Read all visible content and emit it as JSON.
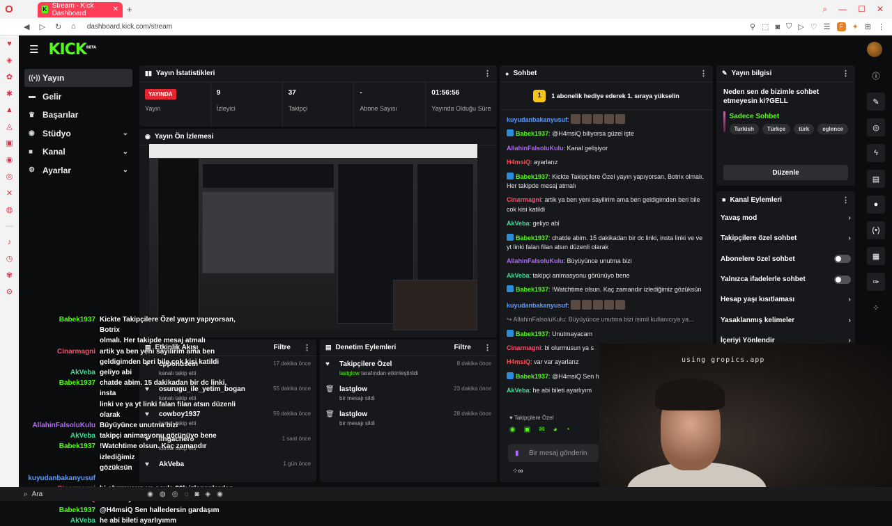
{
  "browser": {
    "tab_title": "Stream - Kick Dashboard",
    "url": "dashboard.kick.com/stream",
    "opera_sidebar_icons": [
      "heart-icon",
      "gift-icon",
      "bug-icon",
      "star-icon",
      "cube-icon",
      "warning-icon",
      "twitch-icon",
      "whatsapp-icon",
      "instagram-icon",
      "x-icon",
      "discord-icon",
      "music-icon",
      "clock-icon",
      "gift-icon",
      "gear-icon"
    ],
    "taskbar_search": "Ara"
  },
  "brand": {
    "logo": "KICK",
    "logo_sup": "BETA",
    "accent": "#53fc18",
    "live_red": "#e5252f"
  },
  "nav": {
    "items": [
      {
        "label": "Yayın",
        "icon": "broadcast-icon",
        "active": true,
        "chevron": false
      },
      {
        "label": "Gelir",
        "icon": "wallet-icon",
        "active": false,
        "chevron": false
      },
      {
        "label": "Başarılar",
        "icon": "trophy-icon",
        "active": false,
        "chevron": false
      },
      {
        "label": "Stüdyo",
        "icon": "studio-icon",
        "active": false,
        "chevron": true
      },
      {
        "label": "Kanal",
        "icon": "channel-icon",
        "active": false,
        "chevron": true
      },
      {
        "label": "Ayarlar",
        "icon": "gear-icon",
        "active": false,
        "chevron": true
      }
    ]
  },
  "stats": {
    "title": "Yayın İstatistikleri",
    "live_badge": "YAYINDA",
    "items": [
      {
        "value": "",
        "label": "Yayın"
      },
      {
        "value": "9",
        "label": "İzleyici"
      },
      {
        "value": "37",
        "label": "Takipçi"
      },
      {
        "value": "-",
        "label": "Abone Sayısı"
      },
      {
        "value": "01:56:56",
        "label": "Yayında Olduğu Süre"
      }
    ]
  },
  "preview": {
    "title": "Yayın Ön İzlemesi"
  },
  "activity": {
    "title": "Etkinlik Akışı",
    "filter": "Filtre",
    "items": [
      {
        "name": "cppohusein",
        "sub": "kanalı takip etti",
        "time": "17 dakika önce"
      },
      {
        "name": "osurugu_ile_yetim_bogan",
        "sub": "kanalı takip etti",
        "time": "55 dakika önce"
      },
      {
        "name": "cowboy1937",
        "sub": "kanalı takip etti",
        "time": "59 dakika önce"
      },
      {
        "name": "lingachero",
        "sub": "kanalı takip etti",
        "time": "1 saat önce"
      },
      {
        "name": "AkVeba",
        "sub": "",
        "time": "1 gün önce"
      }
    ]
  },
  "moderation": {
    "title": "Denetim Eylemleri",
    "filter": "Filtre",
    "items": [
      {
        "icon": "heart-icon",
        "name": "Takipçilere Özel",
        "actor": "lastglow",
        "sub": "tarafından etkinleştirildi",
        "time": "8 dakika önce"
      },
      {
        "icon": "trash-icon",
        "name": "lastglow",
        "actor": "",
        "sub": "bir mesajı sildi",
        "time": "23 dakika önce"
      },
      {
        "icon": "trash-icon",
        "name": "lastglow",
        "actor": "",
        "sub": "bir mesajı sildi",
        "time": "28 dakika önce"
      }
    ]
  },
  "chat": {
    "title": "Sohbet",
    "banner_rank": "1",
    "banner": "1 abonelik hediye ederek 1. sıraya yükselin",
    "messages": [
      {
        "user": "kuyudanbakanyusuf",
        "color": "#5b9bff",
        "badge": false,
        "text": ""
      },
      {
        "user": "Babek1937",
        "color": "#53fc18",
        "badge": true,
        "text": "@H4msiQ biliyorsa güzel işte"
      },
      {
        "user": "AllahinFalsoluKulu",
        "color": "#b266ff",
        "badge": false,
        "text": "Kanal gelişiyor"
      },
      {
        "user": "H4msiQ",
        "color": "#ff4d4d",
        "badge": false,
        "text": "ayarlarız"
      },
      {
        "user": "Babek1937",
        "color": "#53fc18",
        "badge": true,
        "text": "Kickte Takipçilere Özel yayın yapıyorsan, Botrix olmalı. Her takipde mesaj atmalı"
      },
      {
        "user": "Cinarmagni",
        "color": "#ff4d6d",
        "badge": false,
        "text": "artik ya ben yeni sayilirim ama ben geldigimden beri bile cok kisi katildi"
      },
      {
        "user": "AkVeba",
        "color": "#3ddc97",
        "badge": false,
        "text": "geliyo abi"
      },
      {
        "user": "Babek1937",
        "color": "#53fc18",
        "badge": true,
        "text": "chatde abim. 15 dakikadan bir dc linki, insta linki ve ve yt linki falan filan atsın düzenli olarak"
      },
      {
        "user": "AllahinFalsoluKulu",
        "color": "#b266ff",
        "badge": false,
        "text": "Büyüyünce unutma bizi"
      },
      {
        "user": "AkVeba",
        "color": "#3ddc97",
        "badge": false,
        "text": "takipçi animasyonu görünüyo bene"
      },
      {
        "user": "Babek1937",
        "color": "#53fc18",
        "badge": true,
        "text": "!Watchtime olsun. Kaç zamandır izlediğimiz gözüksün"
      },
      {
        "user": "kuyudanbakanyusuf",
        "color": "#5b9bff",
        "badge": false,
        "text": ""
      },
      {
        "user": "",
        "color": "#999",
        "badge": false,
        "text": "↪ AllahinFalsoluKulu: Büyüyünce unutma bizi isimli kullanıcıya ya..."
      },
      {
        "user": "Babek1937",
        "color": "#53fc18",
        "badge": true,
        "text": "Unutmayacam"
      },
      {
        "user": "Cinarmagni",
        "color": "#ff4d6d",
        "badge": false,
        "text": "bi olurmusun ya s"
      },
      {
        "user": "H4msiQ",
        "color": "#ff4d4d",
        "badge": false,
        "text": "var var ayarlarız"
      },
      {
        "user": "Babek1937",
        "color": "#53fc18",
        "badge": true,
        "text": "@H4msiQ Sen h"
      },
      {
        "user": "AkVeba",
        "color": "#3ddc97",
        "badge": false,
        "text": "he abi bileti ayarlıyım"
      }
    ],
    "mode_label": "Takipçilere Özel",
    "input_placeholder": "Bir mesaj gönderin"
  },
  "info": {
    "title": "Yayın bilgisi",
    "stream_title": "Neden sen de bizimle sohbet etmeyesin ki?GELL",
    "category": "Sadece Sohbet",
    "tags": [
      "Turkish",
      "Türkçe",
      "türk",
      "eglence"
    ],
    "edit_label": "Düzenle"
  },
  "channel_actions": {
    "title": "Kanal Eylemleri",
    "items": [
      {
        "label": "Yavaş mod",
        "type": "arrow"
      },
      {
        "label": "Takipçilere özel sohbet",
        "type": "arrow"
      },
      {
        "label": "Abonelere özel sohbet",
        "type": "toggle"
      },
      {
        "label": "Yalnızca ifadelerle sohbet",
        "type": "toggle"
      },
      {
        "label": "Hesap yaşı kısıtlaması",
        "type": "arrow"
      },
      {
        "label": "Yasaklanmış kelimeler",
        "type": "arrow"
      },
      {
        "label": "İçeriyi Yönlendir",
        "type": "arrow"
      }
    ]
  },
  "rail": {
    "icons": [
      "info-icon",
      "pencil-icon",
      "target-icon",
      "bolt-icon",
      "document-icon",
      "chat-bubble-icon",
      "broadcast-icon",
      "save-icon",
      "wrench-icon",
      "dots-icon"
    ]
  },
  "overlay_chat": {
    "lines": [
      {
        "user": "Babek1937",
        "color": "#53fc18",
        "text": "Kickte Takipçilere Özel yayın yapıyorsan, Botrix"
      },
      {
        "user": "",
        "color": "#53fc18",
        "text": "olmalı. Her takipde mesaj atmalı"
      },
      {
        "user": "Cinarmagni",
        "color": "#ff4d6d",
        "text": "artik ya ben yeni sayilirim ama ben"
      },
      {
        "user": "",
        "color": "#ff4d6d",
        "text": "geldigimden beri bile cok kisi katildi"
      },
      {
        "user": "AkVeba",
        "color": "#3ddc97",
        "text": "geliyo abi"
      },
      {
        "user": "Babek1937",
        "color": "#53fc18",
        "text": "chatde abim. 15 dakikadan bir dc linki, insta"
      },
      {
        "user": "",
        "color": "#53fc18",
        "text": "linki ve ya yt linki falan filan atsın düzenli"
      },
      {
        "user": "",
        "color": "#53fc18",
        "text": "olarak"
      },
      {
        "user": "AllahinFalsoluKulu",
        "color": "#b266ff",
        "text": "Büyüyünce unutma bizi"
      },
      {
        "user": "AkVeba",
        "color": "#3ddc97",
        "text": "takipçi animasyonu görünüyo bene"
      },
      {
        "user": "Babek1937",
        "color": "#53fc18",
        "text": "!Watchtime olsun. Kaç zamandır izlediğimiz"
      },
      {
        "user": "",
        "color": "#53fc18",
        "text": "gözüksün"
      },
      {
        "user": "kuyudanbakanyusuf",
        "color": "#5b9bff",
        "text": ""
      },
      {
        "user": "Cinarmagni",
        "color": "#ff4d6d",
        "text": "bi olurmusun ya soyle 20k izlenenlerden"
      },
      {
        "user": "H4msiQ",
        "color": "#ff4d4d",
        "text": "var var ayarlarız"
      },
      {
        "user": "Babek1937",
        "color": "#53fc18",
        "text": "@H4msiQ Sen halledersin gardaşım"
      },
      {
        "user": "AkVeba",
        "color": "#3ddc97",
        "text": "he abi bileti ayarlıyımm"
      }
    ]
  },
  "webcam": {
    "sign_text": "using gropics.app"
  }
}
